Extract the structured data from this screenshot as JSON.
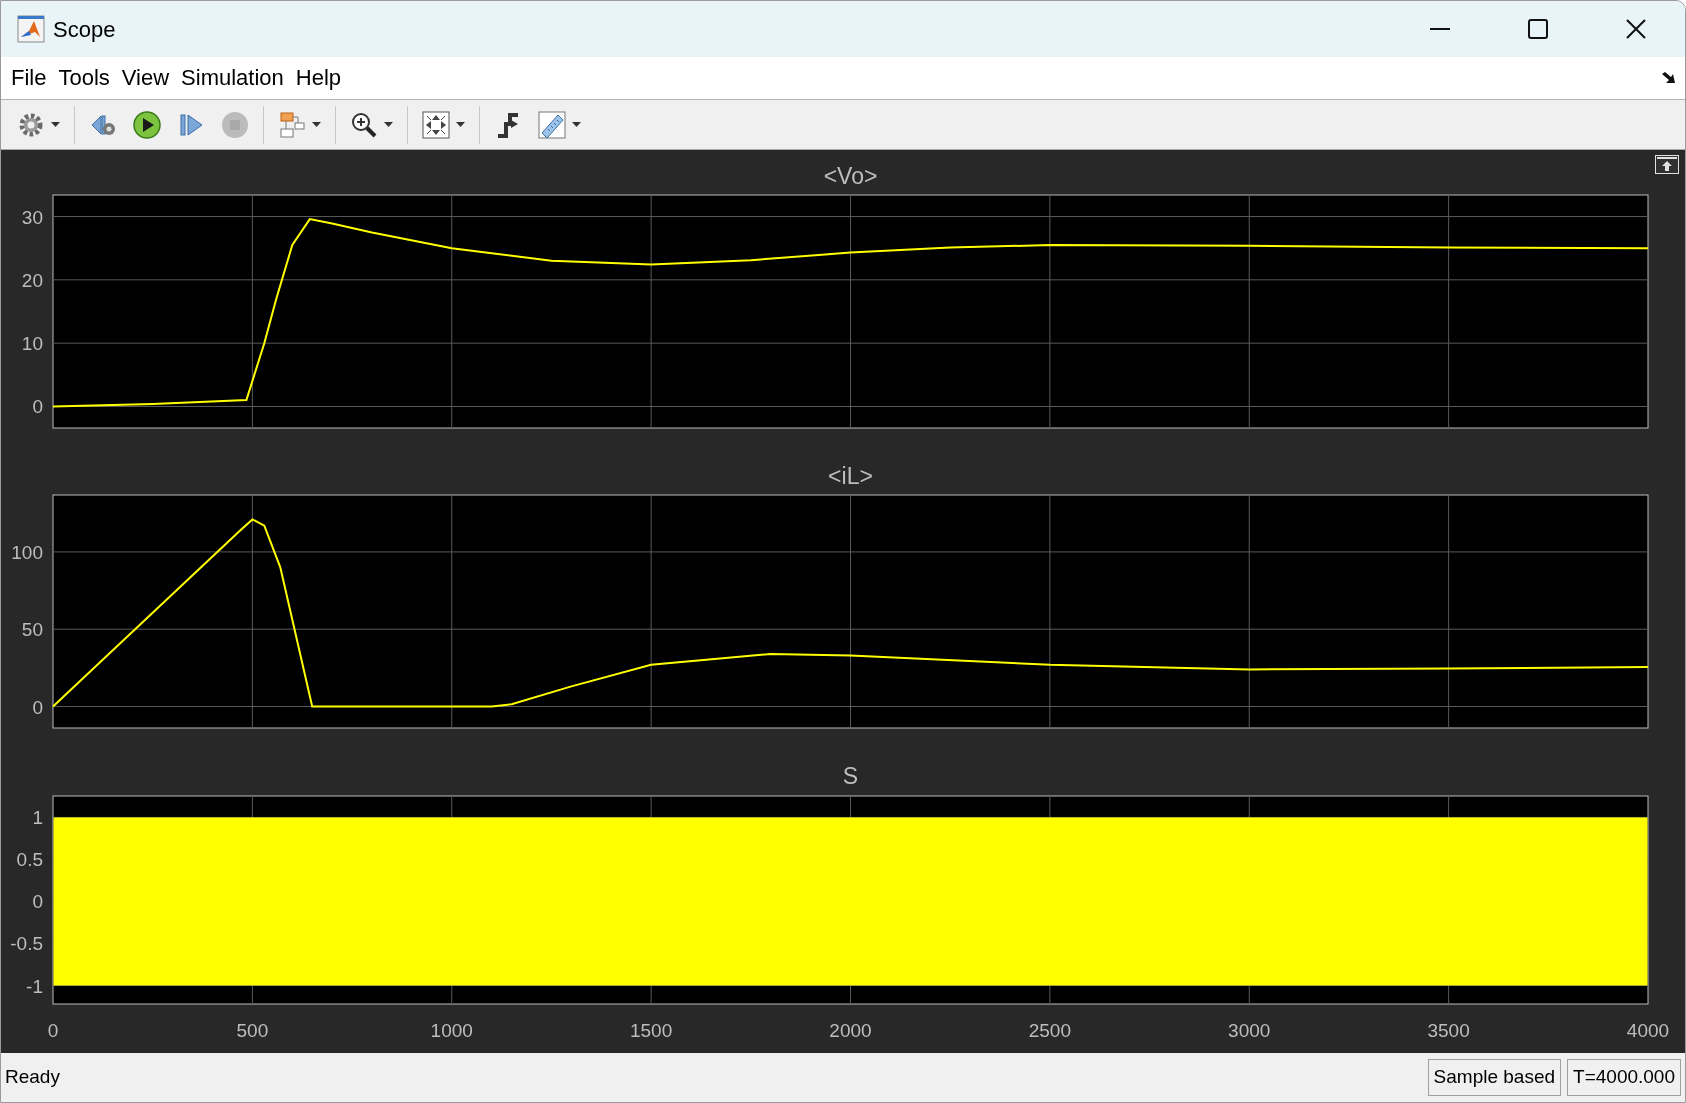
{
  "window": {
    "title": "Scope"
  },
  "menu": [
    {
      "label": "File"
    },
    {
      "label": "Tools"
    },
    {
      "label": "View"
    },
    {
      "label": "Simulation"
    },
    {
      "label": "Help"
    }
  ],
  "toolbar_groups": [
    [
      {
        "kind": "settings",
        "dropdown": true,
        "disabled": false
      }
    ],
    [
      {
        "kind": "step-back",
        "dropdown": false,
        "disabled": false
      },
      {
        "kind": "run",
        "dropdown": false,
        "disabled": false
      },
      {
        "kind": "step-forward",
        "dropdown": false,
        "disabled": false
      },
      {
        "kind": "stop",
        "dropdown": false,
        "disabled": true
      }
    ],
    [
      {
        "kind": "blocks",
        "dropdown": true,
        "disabled": false
      }
    ],
    [
      {
        "kind": "zoom",
        "dropdown": true,
        "disabled": false
      }
    ],
    [
      {
        "kind": "autoscale",
        "dropdown": true,
        "disabled": false
      }
    ],
    [
      {
        "kind": "trigger",
        "dropdown": false,
        "disabled": false
      },
      {
        "kind": "measure",
        "dropdown": true,
        "disabled": false
      }
    ]
  ],
  "plots": [
    {
      "chart_data": {
        "type": "line",
        "title": "<Vo>",
        "grid": true,
        "x": [
          0,
          250,
          485,
          530,
          560,
          600,
          644,
          700,
          800,
          1000,
          1250,
          1500,
          1750,
          2000,
          2250,
          2500,
          3000,
          3500,
          4000
        ],
        "xlim": [
          0,
          4000
        ],
        "ylim": [
          -3.4,
          33.4
        ],
        "yticks": [
          0,
          10,
          20,
          30
        ],
        "series": [
          {
            "color": "#ffff00",
            "values": [
              0,
              0.4,
              1,
              10,
              17,
              25.5,
              29.6,
              28.9,
              27.5,
              25,
              23,
              22.4,
              23.1,
              24.3,
              25.1,
              25.5,
              25.4,
              25.1,
              25.0
            ]
          }
        ]
      }
    },
    {
      "chart_data": {
        "type": "line",
        "title": "<iL>",
        "grid": true,
        "x": [
          0,
          470,
          500,
          530,
          570,
          650,
          1100,
          1150,
          1300,
          1500,
          1800,
          2000,
          2500,
          3000,
          3500,
          4000
        ],
        "xlim": [
          0,
          4000
        ],
        "ylim": [
          -13.9,
          136.8
        ],
        "yticks": [
          0,
          50,
          100
        ],
        "series": [
          {
            "color": "#ffff00",
            "values": [
              0,
              114,
              121,
              117,
              90,
              0,
              0,
              1.5,
              13,
              27,
              34,
              33,
              27,
              24,
              24.5,
              25.5
            ]
          }
        ]
      }
    },
    {
      "chart_data": {
        "type": "area",
        "title": "S",
        "grid": true,
        "xlim": [
          0,
          4000
        ],
        "ylim": [
          -1.22,
          1.255
        ],
        "xticks": [
          0,
          500,
          1000,
          1500,
          2000,
          2500,
          3000,
          3500,
          4000
        ],
        "yticks": [
          -1,
          -0.5,
          0,
          0.5,
          1
        ],
        "bands": [
          {
            "axis": "y",
            "from": -1,
            "to": 1,
            "color": "#ffff00"
          }
        ]
      }
    }
  ],
  "status_bar": {
    "message": "Ready",
    "fields": [
      "Sample based",
      "T=4000.000"
    ]
  }
}
